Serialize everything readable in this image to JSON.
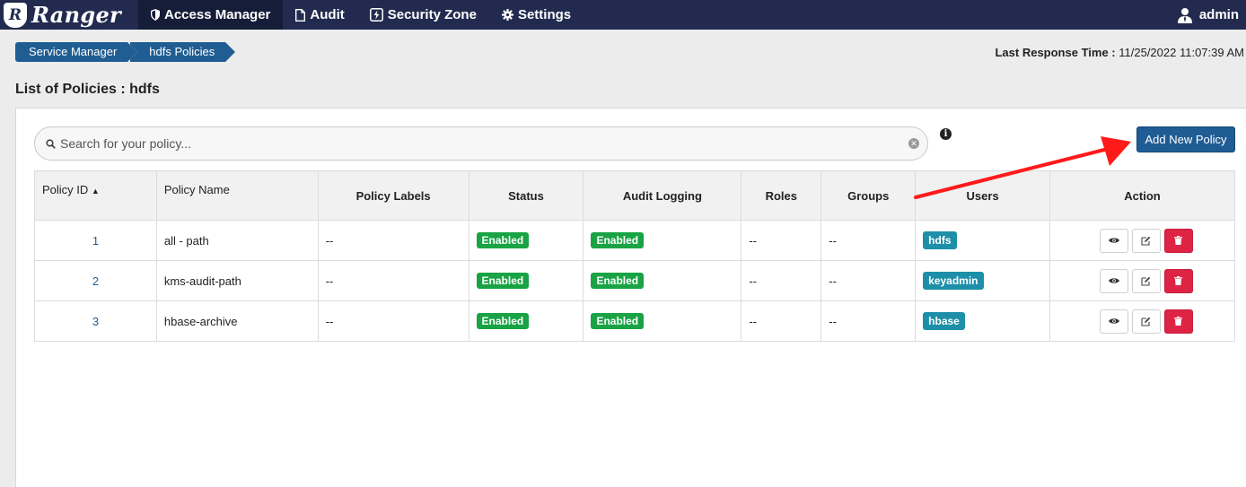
{
  "nav": {
    "brand": "Ranger",
    "brand_badge": "R",
    "items": [
      {
        "label": "Access Manager",
        "active": true
      },
      {
        "label": "Audit"
      },
      {
        "label": "Security Zone"
      },
      {
        "label": "Settings"
      }
    ],
    "user": "admin"
  },
  "breadcrumb": [
    "Service Manager",
    "hdfs Policies"
  ],
  "last_response": {
    "label": "Last Response Time :",
    "value": "11/25/2022 11:07:39 AM"
  },
  "page_title": "List of Policies : hdfs",
  "search": {
    "placeholder": "Search for your policy..."
  },
  "add_button": "Add New Policy",
  "table": {
    "headers": [
      "Policy ID",
      "Policy Name",
      "Policy Labels",
      "Status",
      "Audit Logging",
      "Roles",
      "Groups",
      "Users",
      "Action"
    ],
    "sort_indicator": "▲",
    "rows": [
      {
        "id": "1",
        "name": "all - path",
        "labels": "--",
        "status": "Enabled",
        "audit": "Enabled",
        "roles": "--",
        "groups": "--",
        "users": "hdfs"
      },
      {
        "id": "2",
        "name": "kms-audit-path",
        "labels": "--",
        "status": "Enabled",
        "audit": "Enabled",
        "roles": "--",
        "groups": "--",
        "users": "keyadmin"
      },
      {
        "id": "3",
        "name": "hbase-archive",
        "labels": "--",
        "status": "Enabled",
        "audit": "Enabled",
        "roles": "--",
        "groups": "--",
        "users": "hbase"
      }
    ]
  },
  "colors": {
    "nav_bg": "#222b4f",
    "primary": "#1f5c94",
    "enabled": "#19a344",
    "user_badge": "#1d8fa8",
    "delete": "#dd2445",
    "annotation_arrow": "#ff1a1a"
  }
}
